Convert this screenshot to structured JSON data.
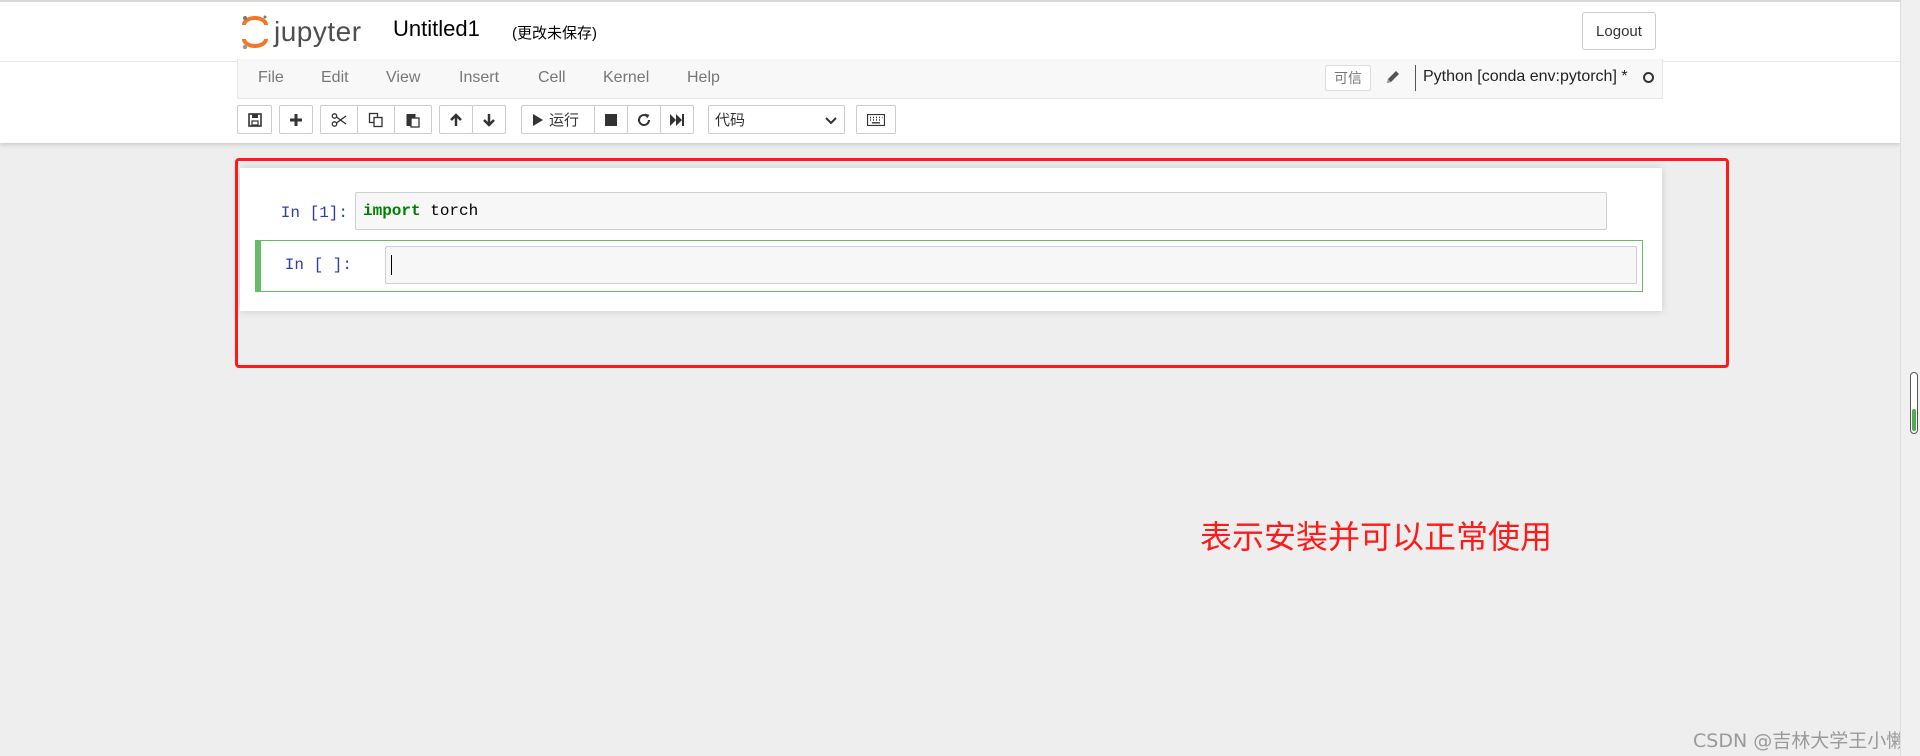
{
  "header": {
    "logo_text": "jupyter",
    "notebook_name": "Untitled1",
    "save_status": "(更改未保存)",
    "logout_label": "Logout"
  },
  "menubar": {
    "items": [
      {
        "label": "File"
      },
      {
        "label": "Edit"
      },
      {
        "label": "View"
      },
      {
        "label": "Insert"
      },
      {
        "label": "Cell"
      },
      {
        "label": "Kernel"
      },
      {
        "label": "Help"
      }
    ],
    "trusted_label": "可信",
    "kernel_name": "Python [conda env:pytorch] *"
  },
  "toolbar": {
    "run_label": "运行",
    "cell_type_selected": "代码",
    "icons": [
      "save-icon",
      "plus-icon",
      "cut-icon",
      "copy-icon",
      "paste-icon",
      "arrow-up-icon",
      "arrow-down-icon",
      "play-icon",
      "stop-icon",
      "restart-icon",
      "fast-forward-icon",
      "keyboard-icon"
    ]
  },
  "cells": [
    {
      "prompt": "In  [1]:",
      "code_keyword": "import",
      "code_rest": " torch"
    },
    {
      "prompt": "In  [ ]:",
      "code_keyword": "",
      "code_rest": ""
    }
  ],
  "annotation": {
    "text": "表示安装并可以正常使用",
    "color": "#ff1a1a"
  },
  "watermark": "CSDN @吉林大学王小懒",
  "colors": {
    "accent_green": "#66bb6a",
    "prompt_blue": "#303f9f",
    "keyword_green": "#008000",
    "logo_orange": "#f37726"
  }
}
